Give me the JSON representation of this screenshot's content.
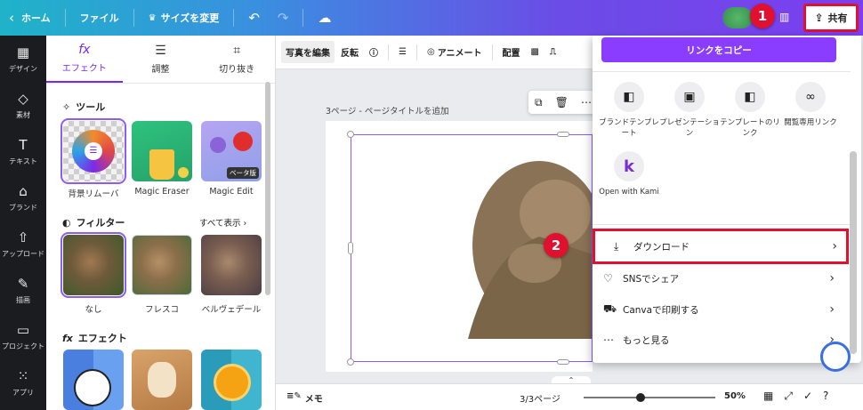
{
  "topbar": {
    "home_label": "ホーム",
    "file_label": "ファイル",
    "resize_label": "サイズを変更",
    "share_label": "共有"
  },
  "rail": {
    "items": [
      {
        "label": "デザイン",
        "icon": "layout-icon"
      },
      {
        "label": "素材",
        "icon": "shapes-icon"
      },
      {
        "label": "テキスト",
        "icon": "text-icon"
      },
      {
        "label": "ブランド",
        "icon": "brand-icon"
      },
      {
        "label": "アップロード",
        "icon": "upload-icon"
      },
      {
        "label": "描画",
        "icon": "draw-icon"
      },
      {
        "label": "プロジェクト",
        "icon": "folder-icon"
      },
      {
        "label": "アプリ",
        "icon": "apps-icon"
      }
    ]
  },
  "panel": {
    "tabs": [
      {
        "label": "エフェクト",
        "icon": "fx-icon"
      },
      {
        "label": "調整",
        "icon": "sliders-icon"
      },
      {
        "label": "切り抜き",
        "icon": "crop-icon"
      }
    ],
    "tools_title": "ツール",
    "tools": [
      {
        "label": "背景リムーバ"
      },
      {
        "label": "Magic Eraser"
      },
      {
        "label": "Magic Edit",
        "badge": "ベータ版"
      }
    ],
    "filters_title": "フィルター",
    "see_all": "すべて表示",
    "filters": [
      {
        "label": "なし"
      },
      {
        "label": "フレスコ"
      },
      {
        "label": "ベルヴェデール"
      }
    ],
    "effects_title": "エフェクト"
  },
  "edit_toolbar": {
    "edit_photo": "写真を編集",
    "flip": "反転",
    "animate": "アニメート",
    "position": "配置"
  },
  "canvas": {
    "page_label": "3ページ - ページタイトルを追加"
  },
  "bottombar": {
    "memo": "メモ",
    "pages": "3/3ページ",
    "zoom": "50%",
    "zoom_fraction": 0.43
  },
  "share_menu": {
    "copy_link": "リンクをコピー",
    "options": [
      {
        "label": "ブランドテンプレート",
        "icon": "brand-template-icon"
      },
      {
        "label": "プレゼンテーション",
        "icon": "presentation-icon"
      },
      {
        "label": "テンプレートのリンク",
        "icon": "template-link-icon"
      },
      {
        "label": "閲覧専用リンク",
        "icon": "link-icon"
      },
      {
        "label": "Open with Kami",
        "icon": "kami-logo-icon"
      }
    ],
    "rows": [
      {
        "label": "ダウンロード",
        "icon": "download-icon"
      },
      {
        "label": "SNSでシェア",
        "icon": "heart-icon"
      },
      {
        "label": "Canvaで印刷する",
        "icon": "truck-icon"
      },
      {
        "label": "もっと見る",
        "icon": "more-icon"
      }
    ]
  },
  "steps": [
    "1",
    "2"
  ],
  "colors": {
    "accent_purple": "#8b3dff",
    "highlight_red": "#e0102e"
  }
}
